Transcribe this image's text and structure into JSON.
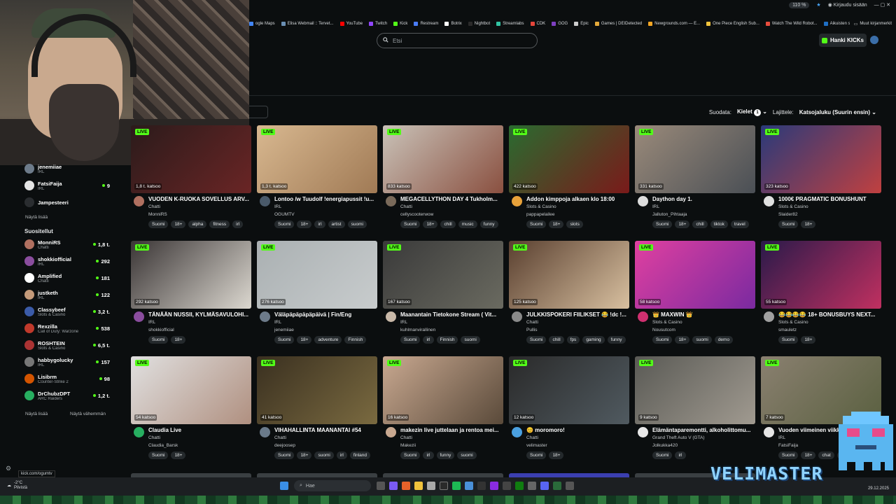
{
  "window_topbar": {
    "zoom": "110 %",
    "login": "Kirjaudu sisään"
  },
  "bookmarks": [
    {
      "label": "ogle Maps",
      "color": "#4285f4"
    },
    {
      "label": "Elisa Webmail :: Tervet...",
      "color": "#6a8fb3"
    },
    {
      "label": "YouTube",
      "color": "#ff0000"
    },
    {
      "label": "Twitch",
      "color": "#9146ff"
    },
    {
      "label": "Kick",
      "color": "#53fc18"
    },
    {
      "label": "Restream",
      "color": "#4a7cf7"
    },
    {
      "label": "Botrix",
      "color": "#ffffff"
    },
    {
      "label": "Nightbot",
      "color": "#2a2a2a"
    },
    {
      "label": "Streamlabs",
      "color": "#31c3a2"
    },
    {
      "label": "CDK",
      "color": "#e4453a"
    },
    {
      "label": "GOG",
      "color": "#7e3fbf"
    },
    {
      "label": "Epic",
      "color": "#cccccc"
    },
    {
      "label": "Games | DEIDetected",
      "color": "#e4a93a"
    },
    {
      "label": "Newgrounds.com — E...",
      "color": "#f5a623"
    },
    {
      "label": "One Piece English Sub...",
      "color": "#f0c23c"
    },
    {
      "label": "Watch The Wild Robot...",
      "color": "#e84c3d"
    },
    {
      "label": "Aikuisten sosiaalipalve...",
      "color": "#1f6fc5"
    }
  ],
  "bookmarks_other": "Muut kirjanmerkit",
  "search": {
    "placeholder": "Etsi"
  },
  "header": {
    "get_kicks": "Hanki KICKs"
  },
  "sort": {
    "filter_label": "Suodata:",
    "languages": "Kielet",
    "languages_count": "1",
    "sort_label": "Lajittele:",
    "sort_value": "Katsojaluku (Suurin ensin)"
  },
  "sidebar": {
    "items_top": [
      {
        "name": "jenemiiaе",
        "sub": "IRL",
        "viewers": "",
        "color": "#6d7b8a"
      },
      {
        "name": "FatsiFaija",
        "sub": "IRL",
        "viewers": "9",
        "color": "#e5e5e5"
      },
      {
        "name": "Jampesteeri",
        "sub": "",
        "viewers": "",
        "color": "#2a2d30"
      }
    ],
    "show_more_1": "Näytä lisää",
    "recommended_heading": "Suositellut",
    "recommended": [
      {
        "name": "MonniRS",
        "sub": "Chatti",
        "viewers": "1,8 t.",
        "color": "#b07060"
      },
      {
        "name": "shokkiofficial",
        "sub": "IRL",
        "viewers": "292",
        "color": "#8a4d9e"
      },
      {
        "name": "Amplified",
        "sub": "Chatti",
        "viewers": "181",
        "color": "#ffffff"
      },
      {
        "name": "justketh",
        "sub": "IRL",
        "viewers": "122",
        "color": "#c49a7a"
      },
      {
        "name": "Classybeef",
        "sub": "Slots & Casino",
        "viewers": "3,2 t.",
        "color": "#3b5ba8"
      },
      {
        "name": "Rexzilla",
        "sub": "Call of Duty: Warzone",
        "viewers": "538",
        "color": "#c0392b"
      },
      {
        "name": "ROSHTEIN",
        "sub": "Slots & Casino",
        "viewers": "6,5 t.",
        "color": "#a33"
      },
      {
        "name": "habbygolucky",
        "sub": "IRL",
        "viewers": "157",
        "color": "#777"
      },
      {
        "name": "Lisibrm",
        "sub": "Counter-Strike 2",
        "viewers": "98",
        "color": "#d35400"
      },
      {
        "name": "DrChubzDPT",
        "sub": "ARC Raiders",
        "viewers": "1,2 t.",
        "color": "#27ae60"
      }
    ],
    "show_more_2": "Näytä lisää",
    "show_less": "Näytä vähemmän"
  },
  "cards": [
    {
      "live": "LIVE",
      "viewers": "1,8 t. katsoo",
      "title": "VUODEN K-RUOKA SOVELLUS ARV...",
      "category": "Chatti",
      "user": "MonniRS",
      "tags": [
        "Suomi",
        "18+",
        "alpha",
        "fitness",
        "irl"
      ],
      "thumb": [
        "#2b1b1b",
        "#6a2525"
      ],
      "ava": "#b07060"
    },
    {
      "live": "LIVE",
      "viewers": "1,3 t. katsoo",
      "title": "Lontoo /w Tuudolf !energiapussit !u...",
      "category": "IRL",
      "user": "OGUMTV",
      "tags": [
        "Suomi",
        "18+",
        "irl",
        "artist",
        "suomi"
      ],
      "thumb": [
        "#d8b890",
        "#a07a55"
      ],
      "ava": "#4a5a6a"
    },
    {
      "live": "LIVE",
      "viewers": "833 katsoo",
      "title": "MEGACELLYTHON DAY 4 Tukholm...",
      "category": "Chatti",
      "user": "cellyscooterwow",
      "tags": [
        "Suomi",
        "18+",
        "chill",
        "music",
        "funny"
      ],
      "thumb": [
        "#c9c2b8",
        "#8a5040"
      ],
      "ava": "#7a6a5a"
    },
    {
      "live": "LIVE",
      "viewers": "422 katsoo",
      "title": "Addon kimppoja alkaen klo 18:00",
      "category": "Slots & Casino",
      "user": "pappapelailee",
      "tags": [
        "Suomi",
        "18+",
        "slots"
      ],
      "thumb": [
        "#2a6b30",
        "#7a1a1a"
      ],
      "ava": "#e8a23a"
    },
    {
      "live": "LIVE",
      "viewers": "331 katsoo",
      "title": "Daython day 1.",
      "category": "IRL",
      "user": "Jalluton_Pihtaaja",
      "tags": [
        "Suomi",
        "18+",
        "chill",
        "tiktok",
        "travel"
      ],
      "thumb": [
        "#9a8a7a",
        "#4a4f55"
      ],
      "ava": "#dddddd"
    },
    {
      "live": "LIVE",
      "viewers": "323 katsoo",
      "title": "1000€ PRAGMATIC BONUSHUNT",
      "category": "Slots & Casino",
      "user": "Slaider82",
      "tags": [
        "Suomi",
        "18+"
      ],
      "thumb": [
        "#2a3a7a",
        "#c04040"
      ],
      "ava": "#e0e0e0"
    },
    {
      "live": "LIVE",
      "viewers": "292 katsoo",
      "title": "TÄNÄÄN NUSSII, KYLMÄSAVULOHI...",
      "category": "IRL",
      "user": "shokkiofficial",
      "tags": [
        "Suomi",
        "18+"
      ],
      "thumb": [
        "#3a3535",
        "#dcd8d0"
      ],
      "ava": "#8a4d9e"
    },
    {
      "live": "LIVE",
      "viewers": "276 katsoo",
      "title": "Väläpäpäpäpäpäivä | Fin/Eng",
      "category": "IRL",
      "user": "jenemiiae",
      "tags": [
        "Suomi",
        "18+",
        "adventure",
        "Finnish"
      ],
      "thumb": [
        "#aab0b2",
        "#c8cccd"
      ],
      "ava": "#6d7b8a"
    },
    {
      "live": "LIVE",
      "viewers": "167 katsoo",
      "title": "Maanantain Tietokone Stream ( Vit...",
      "category": "IRL",
      "user": "kuhlmanvirallinen",
      "tags": [
        "Suomi",
        "irl",
        "Finnish",
        "suomi"
      ],
      "thumb": [
        "#3a3a3a",
        "#6a6a60"
      ],
      "ava": "#c8b8a8"
    },
    {
      "live": "LIVE",
      "viewers": "125 katsoo",
      "title": "JULKKISPOKERI FIILIKSET 😂 !dc !...",
      "category": "Chatti",
      "user": "Pullis",
      "tags": [
        "Suomi",
        "chill",
        "fps",
        "gaming",
        "funny"
      ],
      "thumb": [
        "#5a4030",
        "#d8c0a0"
      ],
      "ava": "#8a8a8a"
    },
    {
      "live": "LIVE",
      "viewers": "58 katsoo",
      "title": "👑 MAXWIN 👑",
      "category": "Slots & Casino",
      "user": "Nousutcom",
      "tags": [
        "Suomi",
        "18+",
        "suomi",
        "demo"
      ],
      "thumb": [
        "#e040a0",
        "#7a2aa0"
      ],
      "ava": "#d03070"
    },
    {
      "live": "LIVE",
      "viewers": "55 katsoo",
      "title": "😂😂😂😂 18+ BONUSBUYS NEXT...",
      "category": "Slots & Casino",
      "user": "smauletz",
      "tags": [
        "Suomi",
        "18+"
      ],
      "thumb": [
        "#2a1a4a",
        "#c03060"
      ],
      "ava": "#a0a0a0"
    },
    {
      "live": "LIVE",
      "viewers": "54 katsoo",
      "title": "Claudia Live",
      "category": "Chatti",
      "user": "Claudia_Barsk",
      "tags": [
        "Suomi",
        "18+"
      ],
      "thumb": [
        "#e0e0e0",
        "#b09080"
      ],
      "ava": "#27ae60"
    },
    {
      "live": "LIVE",
      "viewers": "41 katsoo",
      "title": "VIHAHALLINTA MAANANTAI #54",
      "category": "Chatti",
      "user": "deejoosep",
      "tags": [
        "Suomi",
        "18+",
        "suomi",
        "irl",
        "finland"
      ],
      "thumb": [
        "#3a3020",
        "#7a6a40"
      ],
      "ava": "#6a7a8a"
    },
    {
      "live": "LIVE",
      "viewers": "16 katsoo",
      "title": "makezin live juttelaan ja rentoa mei...",
      "category": "Chatti",
      "user": "Makezii",
      "tags": [
        "Suomi",
        "irl",
        "funny",
        "suomi"
      ],
      "thumb": [
        "#c8a890",
        "#5a4a3a"
      ],
      "ava": "#c8a890"
    },
    {
      "live": "LIVE",
      "viewers": "12 katsoo",
      "title": "😊 moromoro!",
      "category": "Chatti",
      "user": "velimaster",
      "tags": [
        "Suomi",
        "18+"
      ],
      "thumb": [
        "#2a2a2a",
        "#505a60"
      ],
      "ava": "#4aa0e0"
    },
    {
      "live": "LIVE",
      "viewers": "9 katsoo",
      "title": "Elämäntaparemontti, alkoholittomu...",
      "category": "Grand Theft Auto V (GTA)",
      "user": "Jolkukka420",
      "tags": [
        "Suomi",
        "irl"
      ],
      "thumb": [
        "#5a5a55",
        "#a09a90"
      ],
      "ava": "#e8e8e8"
    },
    {
      "live": "LIVE",
      "viewers": "7 katsoo",
      "title": "Vuoden viimeinen viikko",
      "category": "IRL",
      "user": "FatsiFaija",
      "tags": [
        "Suomi",
        "18+",
        "chat",
        "irl"
      ],
      "thumb": [
        "#8a8070",
        "#5a6040"
      ],
      "ava": "#e5e5e5"
    }
  ],
  "status_url": "kick.com/ogumtv",
  "taskbar": {
    "temp": "-2°C",
    "weather": "Pilvistä",
    "search": "Hae",
    "time": "",
    "date": "29.12.2025"
  },
  "overlay_brand": "VELIMASTER"
}
